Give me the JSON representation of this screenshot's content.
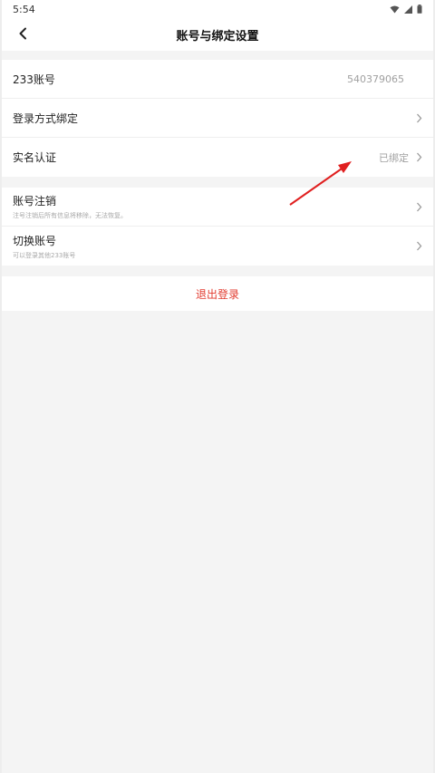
{
  "status_bar": {
    "time": "5:54"
  },
  "header": {
    "title": "账号与绑定设置"
  },
  "section1": {
    "rows": [
      {
        "label": "233账号",
        "value": "540379065"
      },
      {
        "label": "登录方式绑定",
        "value": ""
      },
      {
        "label": "实名认证",
        "value": "已绑定"
      }
    ]
  },
  "section2": {
    "rows": [
      {
        "label": "账号注销",
        "sub": "注号注销后所有信息将移除，无法恢复。"
      },
      {
        "label": "切换账号",
        "sub": "可以登录其他233账号"
      }
    ]
  },
  "logout": {
    "label": "退出登录"
  },
  "colors": {
    "accent": "#e23b2f",
    "annotation_arrow": "#e02020"
  },
  "icons": [
    "wifi-icon",
    "signal-icon",
    "battery-icon",
    "back-arrow-icon",
    "chevron-right-icon"
  ]
}
